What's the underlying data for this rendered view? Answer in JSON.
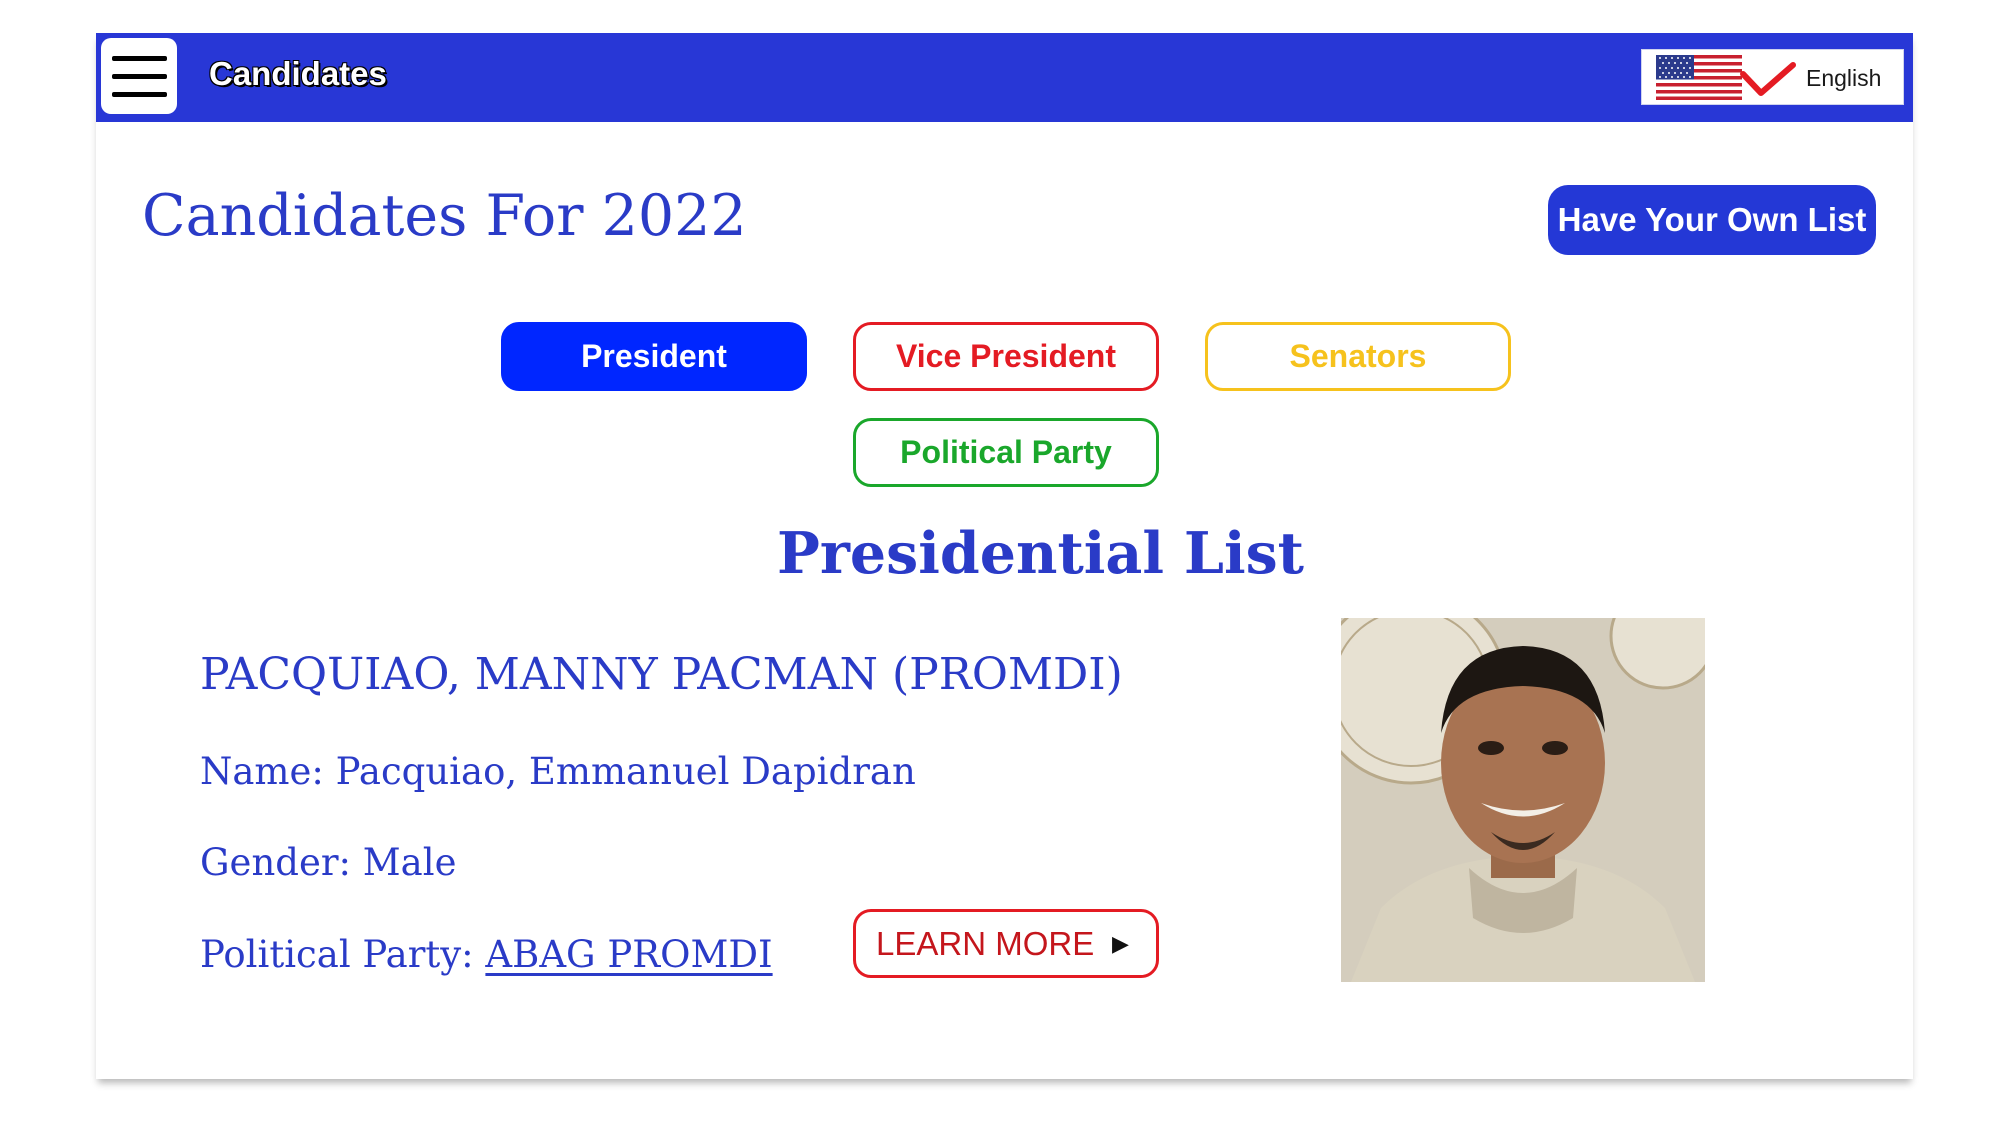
{
  "topbar": {
    "title": "Candidates",
    "menu_icon": "hamburger-menu-icon",
    "language": {
      "flag_icon": "us-flag-icon",
      "check_icon": "checkmark-icon",
      "label": "English"
    }
  },
  "page": {
    "title": "Candidates For 2022",
    "own_list_button": "Have Your Own List"
  },
  "tabs": [
    {
      "label": "President",
      "active": true,
      "color": "#0026ff"
    },
    {
      "label": "Vice President",
      "active": false,
      "color": "#e41b23"
    },
    {
      "label": "Senators",
      "active": false,
      "color": "#f6c21d"
    },
    {
      "label": "Political Party",
      "active": false,
      "color": "#1aa72b"
    }
  ],
  "list": {
    "title": "Presidential List",
    "candidate": {
      "heading": "PACQUIAO, MANNY PACMAN (PROMDI)",
      "name_label": "Name:",
      "name_value": "Pacquiao, Emmanuel Dapidran",
      "gender_label": "Gender:",
      "gender_value": "Male",
      "party_label": "Political Party:",
      "party_value": "ABAG PROMDI",
      "learn_more": "LEARN MORE",
      "learn_more_icon": "play-arrow-icon",
      "photo": "candidate-portrait"
    }
  },
  "colors": {
    "brand_blue": "#2837d6",
    "text_blue": "#2a3bc7",
    "red": "#e41b23",
    "yellow": "#f6c21d",
    "green": "#1aa72b"
  }
}
